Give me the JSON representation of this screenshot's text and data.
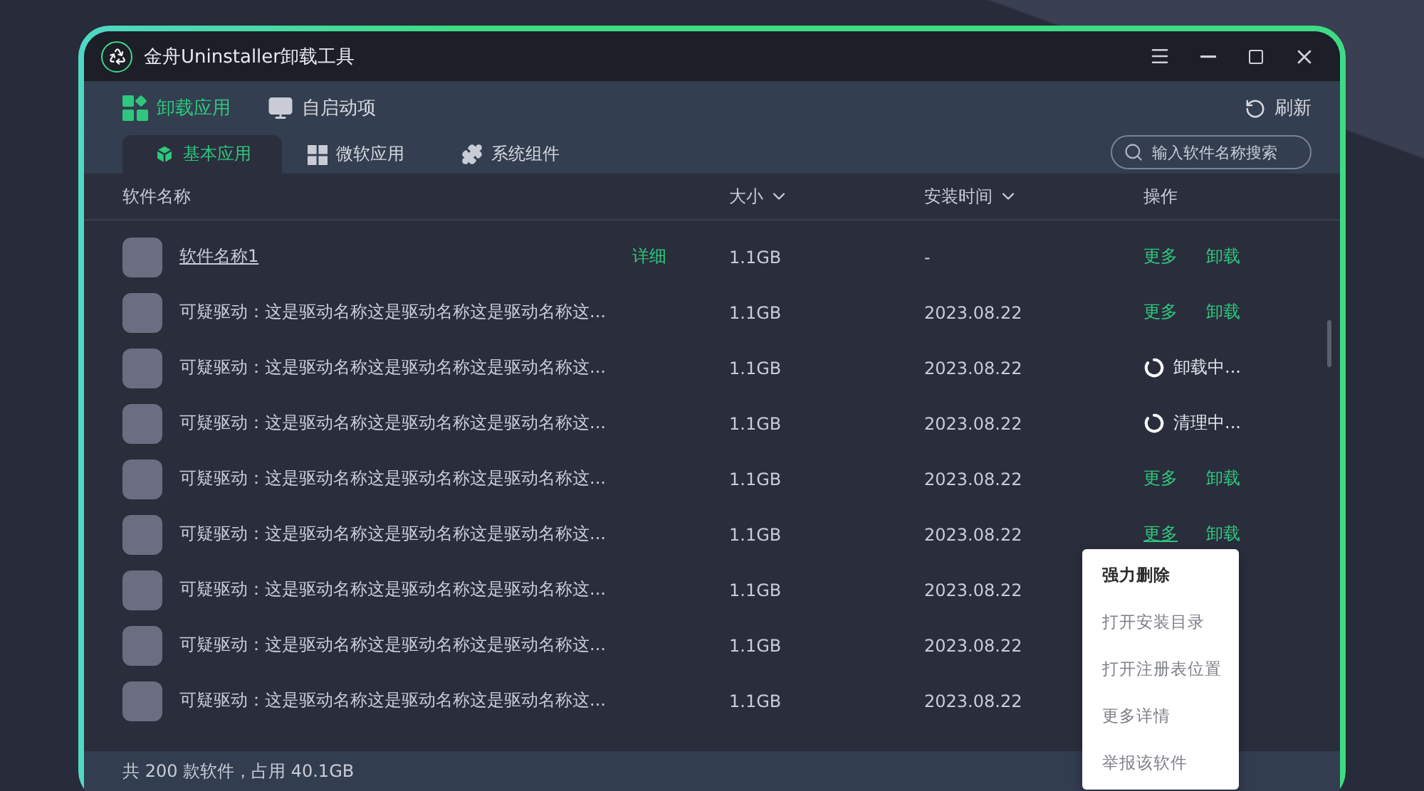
{
  "window": {
    "title": "金舟Uninstaller卸载工具"
  },
  "nav": [
    {
      "label": "卸载应用",
      "selected": true
    },
    {
      "label": "自启动项",
      "selected": false
    }
  ],
  "refresh": "刷新",
  "tabs": [
    {
      "label": "基本应用",
      "selected": true
    },
    {
      "label": "微软应用",
      "selected": false
    },
    {
      "label": "系统组件",
      "selected": false
    }
  ],
  "search": {
    "placeholder": "输入软件名称搜索"
  },
  "columns": [
    {
      "label": "软件名称",
      "sortable": false
    },
    {
      "label": "大小",
      "sortable": true
    },
    {
      "label": "安装时间",
      "sortable": true
    },
    {
      "label": "操作",
      "sortable": false
    }
  ],
  "rows": [
    {
      "name": "软件名称1",
      "hovered": true,
      "detail": "详细",
      "size": "1.1GB",
      "date": "-",
      "kind": "actions",
      "actions": [
        {
          "label": "更多",
          "hovered": false
        },
        {
          "label": "卸载",
          "hovered": false
        }
      ]
    },
    {
      "name": "可疑驱动：这是驱动名称这是驱动名称这是驱动名称这...",
      "hovered": false,
      "size": "1.1GB",
      "date": "2023.08.22",
      "kind": "actions",
      "actions": [
        {
          "label": "更多",
          "hovered": false
        },
        {
          "label": "卸载",
          "hovered": false
        }
      ]
    },
    {
      "name": "可疑驱动：这是驱动名称这是驱动名称这是驱动名称这...",
      "hovered": false,
      "size": "1.1GB",
      "date": "2023.08.22",
      "kind": "progress",
      "status": "卸载中..."
    },
    {
      "name": "可疑驱动：这是驱动名称这是驱动名称这是驱动名称这...",
      "hovered": false,
      "size": "1.1GB",
      "date": "2023.08.22",
      "kind": "progress",
      "status": "清理中..."
    },
    {
      "name": "可疑驱动：这是驱动名称这是驱动名称这是驱动名称这...",
      "hovered": false,
      "size": "1.1GB",
      "date": "2023.08.22",
      "kind": "actions",
      "actions": [
        {
          "label": "更多",
          "hovered": false
        },
        {
          "label": "卸载",
          "hovered": false
        }
      ]
    },
    {
      "name": "可疑驱动：这是驱动名称这是驱动名称这是驱动名称这...",
      "hovered": false,
      "size": "1.1GB",
      "date": "2023.08.22",
      "kind": "actions",
      "actions": [
        {
          "label": "更多",
          "hovered": true
        },
        {
          "label": "卸载",
          "hovered": false
        }
      ]
    },
    {
      "name": "可疑驱动：这是驱动名称这是驱动名称这是驱动名称这...",
      "hovered": false,
      "size": "1.1GB",
      "date": "2023.08.22",
      "kind": "covered"
    },
    {
      "name": "可疑驱动：这是驱动名称这是驱动名称这是驱动名称这...",
      "hovered": false,
      "size": "1.1GB",
      "date": "2023.08.22",
      "kind": "covered"
    },
    {
      "name": "可疑驱动：这是驱动名称这是驱动名称这是驱动名称这...",
      "hovered": false,
      "size": "1.1GB",
      "date": "2023.08.22",
      "kind": "covered"
    }
  ],
  "status_bar": "共 200 款软件，占用 40.1GB",
  "context_menu": [
    {
      "label": "强力删除",
      "selected": true
    },
    {
      "label": "打开安装目录",
      "selected": false
    },
    {
      "label": "打开注册表位置",
      "selected": false
    },
    {
      "label": "更多详情",
      "selected": false
    },
    {
      "label": "举报该软件",
      "selected": false
    }
  ]
}
